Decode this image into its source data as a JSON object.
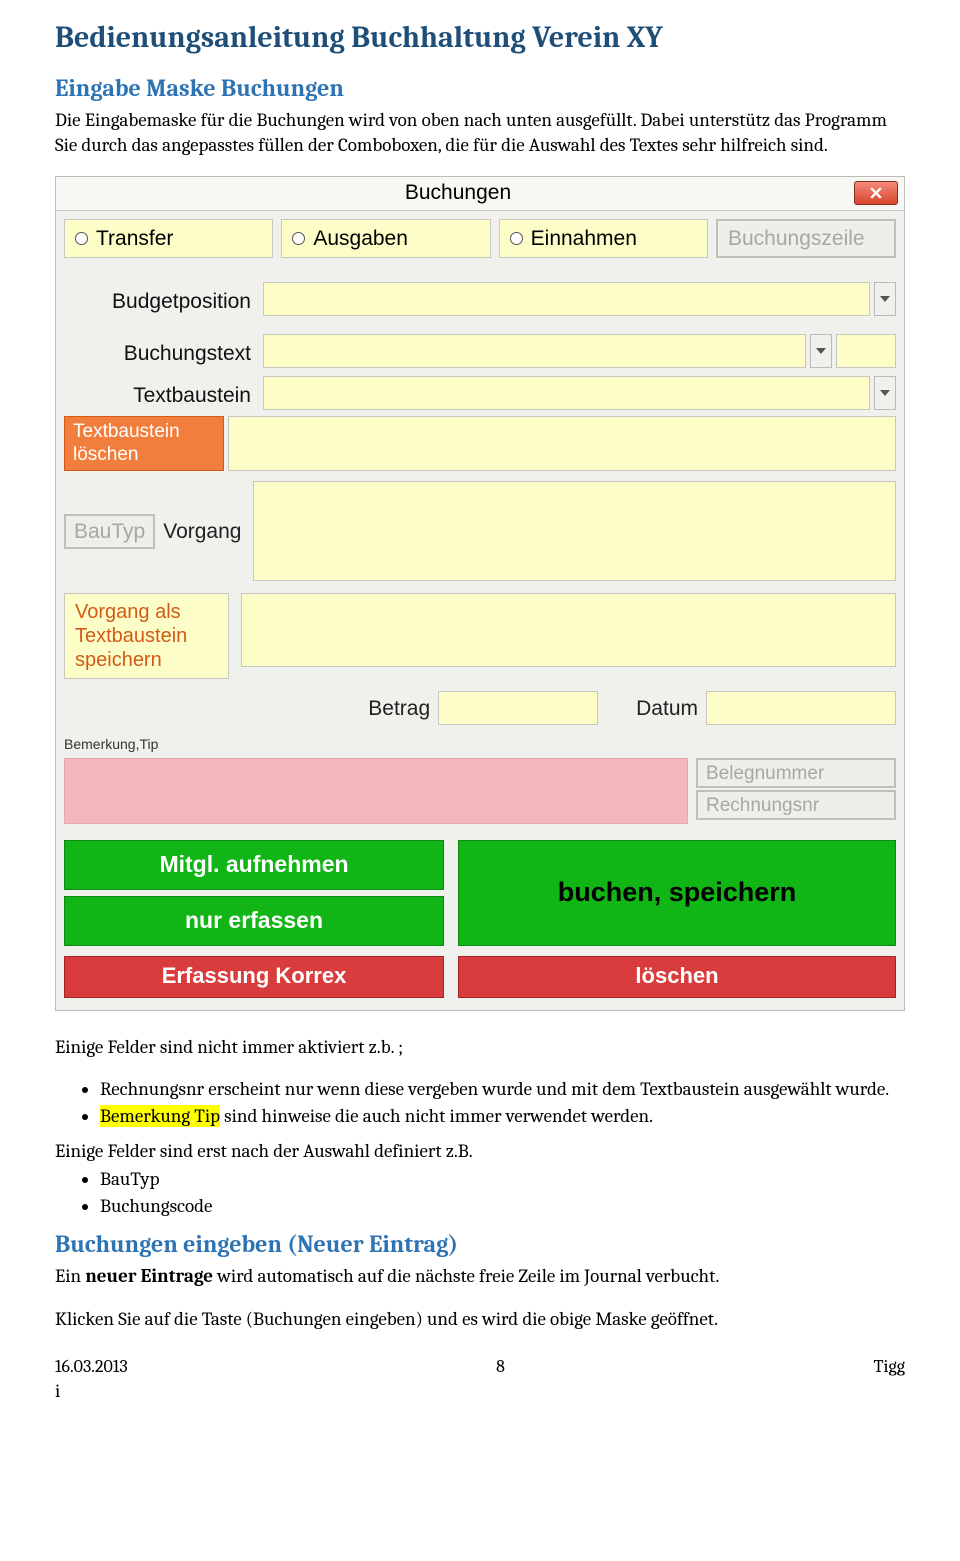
{
  "doc": {
    "h1": "Bedienungsanleitung  Buchhaltung Verein XY",
    "h2a": "Eingabe Maske Buchungen",
    "p1": "Die Eingabemaske für die Buchungen wird von oben nach unten ausgefüllt. Dabei unterstütz das Programm Sie durch das angepasstes füllen der Comboboxen, die für die Auswahl des Textes sehr hilfreich sind.",
    "p2": "Einige Felder sind nicht immer aktiviert z.b. ;",
    "li1": "Rechnungsnr erscheint nur wenn diese vergeben wurde und mit dem Textbaustein ausgewählt wurde.",
    "li2_hl": "Bemerkung Tip",
    "li2_rest": " sind hinweise die auch nicht immer verwendet werden.",
    "p3": "Einige Felder sind erst nach der Auswahl definiert z.B.",
    "li3": "BauTyp",
    "li4": "Buchungscode",
    "h2b": "Buchungen eingeben (Neuer Eintrag)",
    "p4a": "Ein ",
    "p4b": "neuer Eintrage",
    "p4c": " wird automatisch auf die nächste freie Zeile im Journal verbucht.",
    "p5": "Klicken Sie auf die Taste (Buchungen eingeben) und es wird die obige Maske geöffnet."
  },
  "shot": {
    "title": "Buchungen",
    "radios": [
      "Transfer",
      "Ausgaben",
      "Einnahmen"
    ],
    "buchungszeile": "Buchungszeile",
    "labels": {
      "budget": "Budgetposition",
      "buchungstext": "Buchungstext",
      "textbaustein": "Textbaustein",
      "tb_loeschen": "Textbaustein löschen",
      "bautyp": "BauTyp",
      "vorgang": "Vorgang",
      "vorgang_speichern": "Vorgang als Textbaustein speichern",
      "betrag": "Betrag",
      "datum": "Datum",
      "bemerkung": "Bemerkung,Tip",
      "belegnr": "Belegnummer",
      "rechnr": "Rechnungsnr"
    },
    "buttons": {
      "mitgl": "Mitgl. aufnehmen",
      "nur_erfassen": "nur erfassen",
      "buchen": "buchen, speichern",
      "korrex": "Erfassung Korrex",
      "loeschen": "löschen"
    }
  },
  "footer": {
    "date": "16.03.2013",
    "page": "8",
    "author": "Tigg",
    "i": "i"
  }
}
